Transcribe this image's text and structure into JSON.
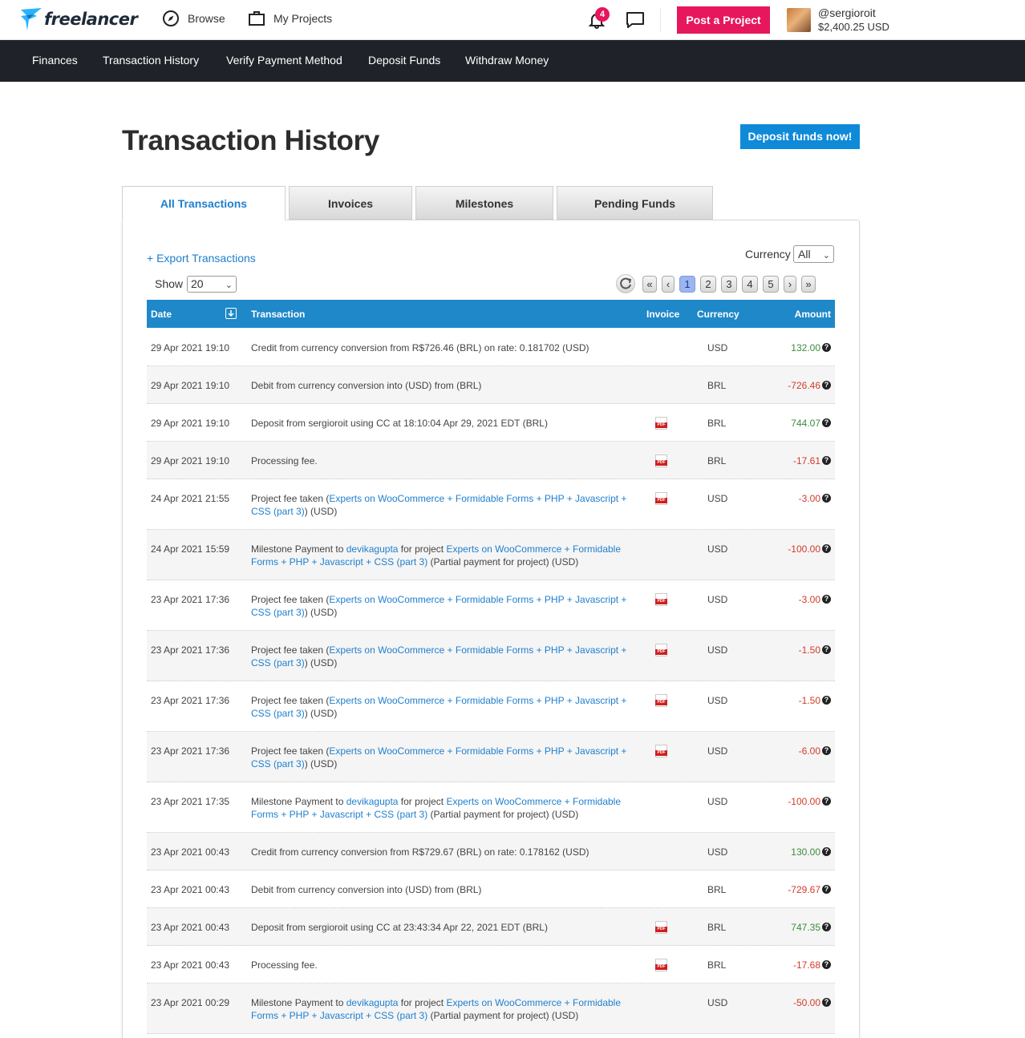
{
  "brand": {
    "name": "freelancer"
  },
  "topnav": {
    "browse": "Browse",
    "my_projects": "My Projects",
    "notifications_count": "4",
    "post_project": "Post a Project",
    "username": "@sergioroit",
    "balance": "$2,400.25 USD"
  },
  "subnav": [
    "Finances",
    "Transaction History",
    "Verify Payment Method",
    "Deposit Funds",
    "Withdraw Money"
  ],
  "page": {
    "title": "Transaction History",
    "deposit_button": "Deposit funds now!",
    "tabs": [
      "All Transactions",
      "Invoices",
      "Milestones",
      "Pending Funds"
    ],
    "export": "+ Export Transactions",
    "currency_label": "Currency",
    "currency_value": "All",
    "show_label": "Show",
    "show_value": "20",
    "pagination": [
      "«",
      "‹",
      "1",
      "2",
      "3",
      "4",
      "5",
      "›",
      "»"
    ],
    "current_page": "1"
  },
  "table": {
    "headers": {
      "date": "Date",
      "transaction": "Transaction",
      "invoice": "Invoice",
      "currency": "Currency",
      "amount": "Amount"
    },
    "rows": [
      {
        "date": "29 Apr 2021 19:10",
        "parts": [
          [
            "t",
            "Credit from currency conversion from R$726.46 (BRL) on rate: 0.181702 (USD)"
          ]
        ],
        "invoice": false,
        "currency": "USD",
        "amount": "132.00",
        "sign": "pos"
      },
      {
        "date": "29 Apr 2021 19:10",
        "parts": [
          [
            "t",
            "Debit from currency conversion into (USD) from (BRL)"
          ]
        ],
        "invoice": false,
        "currency": "BRL",
        "amount": "-726.46",
        "sign": "neg"
      },
      {
        "date": "29 Apr 2021 19:10",
        "parts": [
          [
            "t",
            "Deposit from sergioroit using CC at 18:10:04 Apr 29, 2021 EDT (BRL)"
          ]
        ],
        "invoice": true,
        "currency": "BRL",
        "amount": "744.07",
        "sign": "pos"
      },
      {
        "date": "29 Apr 2021 19:10",
        "parts": [
          [
            "t",
            "Processing fee."
          ]
        ],
        "invoice": true,
        "currency": "BRL",
        "amount": "-17.61",
        "sign": "neg"
      },
      {
        "date": "24 Apr 2021 21:55",
        "parts": [
          [
            "t",
            "Project fee taken ("
          ],
          [
            "l",
            "Experts on WooCommerce + Formidable Forms + PHP + Javascript + CSS (part 3)"
          ],
          [
            "t",
            ") (USD)"
          ]
        ],
        "invoice": true,
        "currency": "USD",
        "amount": "-3.00",
        "sign": "neg"
      },
      {
        "date": "24 Apr 2021 15:59",
        "parts": [
          [
            "t",
            "Milestone Payment to "
          ],
          [
            "l",
            "devikagupta"
          ],
          [
            "t",
            " for project "
          ],
          [
            "l",
            "Experts on WooCommerce + Formidable Forms + PHP + Javascript + CSS (part 3)"
          ],
          [
            "t",
            " (Partial payment for project) (USD)"
          ]
        ],
        "invoice": false,
        "currency": "USD",
        "amount": "-100.00",
        "sign": "neg"
      },
      {
        "date": "23 Apr 2021 17:36",
        "parts": [
          [
            "t",
            "Project fee taken ("
          ],
          [
            "l",
            "Experts on WooCommerce + Formidable Forms + PHP + Javascript + CSS (part 3)"
          ],
          [
            "t",
            ") (USD)"
          ]
        ],
        "invoice": true,
        "currency": "USD",
        "amount": "-3.00",
        "sign": "neg"
      },
      {
        "date": "23 Apr 2021 17:36",
        "parts": [
          [
            "t",
            "Project fee taken ("
          ],
          [
            "l",
            "Experts on WooCommerce + Formidable Forms + PHP + Javascript + CSS (part 3)"
          ],
          [
            "t",
            ") (USD)"
          ]
        ],
        "invoice": true,
        "currency": "USD",
        "amount": "-1.50",
        "sign": "neg"
      },
      {
        "date": "23 Apr 2021 17:36",
        "parts": [
          [
            "t",
            "Project fee taken ("
          ],
          [
            "l",
            "Experts on WooCommerce + Formidable Forms + PHP + Javascript + CSS (part 3)"
          ],
          [
            "t",
            ") (USD)"
          ]
        ],
        "invoice": true,
        "currency": "USD",
        "amount": "-1.50",
        "sign": "neg"
      },
      {
        "date": "23 Apr 2021 17:36",
        "parts": [
          [
            "t",
            "Project fee taken ("
          ],
          [
            "l",
            "Experts on WooCommerce + Formidable Forms + PHP + Javascript + CSS (part 3)"
          ],
          [
            "t",
            ") (USD)"
          ]
        ],
        "invoice": true,
        "currency": "USD",
        "amount": "-6.00",
        "sign": "neg"
      },
      {
        "date": "23 Apr 2021 17:35",
        "parts": [
          [
            "t",
            "Milestone Payment to "
          ],
          [
            "l",
            "devikagupta"
          ],
          [
            "t",
            " for project "
          ],
          [
            "l",
            "Experts on WooCommerce + Formidable Forms + PHP + Javascript + CSS (part 3)"
          ],
          [
            "t",
            " (Partial payment for project) (USD)"
          ]
        ],
        "invoice": false,
        "currency": "USD",
        "amount": "-100.00",
        "sign": "neg"
      },
      {
        "date": "23 Apr 2021 00:43",
        "parts": [
          [
            "t",
            "Credit from currency conversion from R$729.67 (BRL) on rate: 0.178162 (USD)"
          ]
        ],
        "invoice": false,
        "currency": "USD",
        "amount": "130.00",
        "sign": "pos"
      },
      {
        "date": "23 Apr 2021 00:43",
        "parts": [
          [
            "t",
            "Debit from currency conversion into (USD) from (BRL)"
          ]
        ],
        "invoice": false,
        "currency": "BRL",
        "amount": "-729.67",
        "sign": "neg"
      },
      {
        "date": "23 Apr 2021 00:43",
        "parts": [
          [
            "t",
            "Deposit from sergioroit using CC at 23:43:34 Apr 22, 2021 EDT (BRL)"
          ]
        ],
        "invoice": true,
        "currency": "BRL",
        "amount": "747.35",
        "sign": "pos"
      },
      {
        "date": "23 Apr 2021 00:43",
        "parts": [
          [
            "t",
            "Processing fee."
          ]
        ],
        "invoice": true,
        "currency": "BRL",
        "amount": "-17.68",
        "sign": "neg"
      },
      {
        "date": "23 Apr 2021 00:29",
        "parts": [
          [
            "t",
            "Milestone Payment to "
          ],
          [
            "l",
            "devikagupta"
          ],
          [
            "t",
            " for project "
          ],
          [
            "l",
            "Experts on WooCommerce + Formidable Forms + PHP + Javascript + CSS (part 3)"
          ],
          [
            "t",
            " (Partial payment for project) (USD)"
          ]
        ],
        "invoice": false,
        "currency": "USD",
        "amount": "-50.00",
        "sign": "neg"
      }
    ]
  },
  "colors": {
    "accent": "#1f7fce",
    "brand_pink": "#e6175c",
    "header_blue": "#1f88c8",
    "subnav_bg": "#1f2329",
    "positive": "#3c8c3c",
    "negative": "#d23b2a"
  }
}
